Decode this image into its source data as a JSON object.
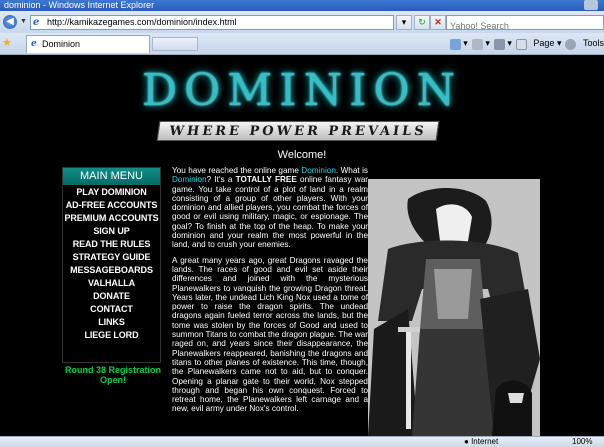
{
  "window": {
    "title": "dominion - Windows Internet Explorer"
  },
  "toolbar": {
    "url": "http://kamikazegames.com/dominion/index.html",
    "search_placeholder": "Yahoo! Search"
  },
  "tabs": {
    "active_label": "Dominion"
  },
  "command_bar": {
    "page_label": "Page",
    "tools_label": "Tools"
  },
  "site": {
    "logo_text": "DOMINION",
    "tagline": "WHERE POWER PREVAILS",
    "welcome": "Welcome!"
  },
  "menu": {
    "title": "MAIN MENU",
    "items": [
      "PLAY DOMINION",
      "AD-FREE ACCOUNTS",
      "PREMIUM ACCOUNTS",
      "SIGN UP",
      "READ THE RULES",
      "STRATEGY GUIDE",
      "MESSAGEBOARDS",
      "VALHALLA",
      "DONATE",
      "CONTACT",
      "LINKS",
      "LIEGE LORD"
    ],
    "registration_notice": "Round 38 Registration Open!"
  },
  "intro": {
    "p1_a": "You have reached the online game ",
    "p1_game1": "Dominion",
    "p1_b": ". What is ",
    "p1_game2": "Dominion",
    "p1_c": "? It's a ",
    "p1_free": "TOTALLY FREE",
    "p1_d": " online fantasy war game. You take control of a plot of land in a realm consisting of a group of other players. With your dominion and allied players, you combat the forces of good or evil using military, magic, or espionage. The goal? To finish at the top of the heap. To make your dominion and your realm the most powerful in the land, and to crush your enemies.",
    "p2": "A great many years ago, great Dragons ravaged the lands. The races of good and evil set aside their differences and joined with the mysterious Planewalkers to vanquish the growing Dragon threat. Years later, the undead Lich King Nox used a tome of power to raise the dragon spirits. The undead dragons again fueled terror across the lands, but the tome was stolen by the forces of Good and used to summon Titans to combat the dragon plague. The war raged on, and years since their disappearance, the Planewalkers reappeared, banishing the dragons and titans to other planes of existence. This time, though, the Planewalkers came not to aid, but to conquer. Opening a planar gate to their world, Nox stepped through and began his own conquest. Forced to retreat home, the Planewalkers left carnage and a new, evil army under Nox's control."
  },
  "status": {
    "zone": "Internet",
    "zoom": "100%"
  },
  "colors": {
    "accent": "#25d1d8",
    "menu_header": "#0d8e86",
    "registration": "#00d04a"
  },
  "icons": [
    "back-icon",
    "forward-icon",
    "ie-logo-icon",
    "refresh-icon",
    "stop-icon",
    "favorites-star-icon",
    "home-icon",
    "feeds-icon",
    "print-icon",
    "page-icon",
    "tools-gear-icon",
    "globe-icon"
  ]
}
